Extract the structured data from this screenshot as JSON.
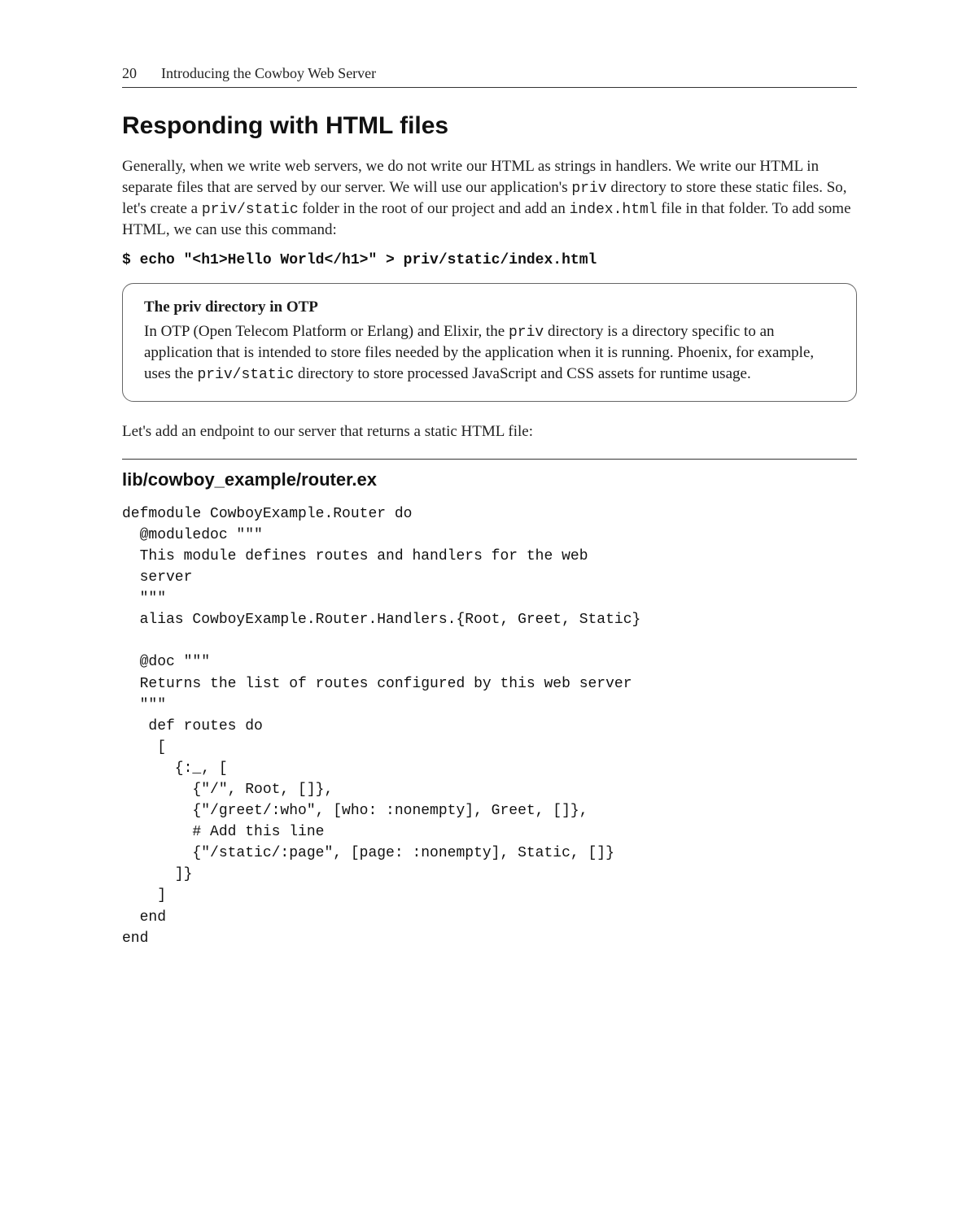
{
  "header": {
    "pageNumber": "20",
    "runningTitle": "Introducing the Cowboy Web Server"
  },
  "section": {
    "title": "Responding with HTML files",
    "para1_a": "Generally, when we write web servers, we do not write our HTML as strings in handlers. We write our HTML in separate files that are served by our server. We will use our application's ",
    "para1_code1": "priv",
    "para1_b": " directory to store these static files. So, let's create a ",
    "para1_code2": "priv/static",
    "para1_c": " folder in the root of our project and add an ",
    "para1_code3": "index.html",
    "para1_d": " file in that folder. To add some HTML, we can use this command:",
    "command": "$ echo \"<h1>Hello World</h1>\" > priv/static/index.html",
    "note": {
      "title": "The priv directory in OTP",
      "body_a": "In OTP (Open Telecom Platform or Erlang) and Elixir, the ",
      "body_code1": "priv",
      "body_b": " directory is a directory specific to an application that is intended to store files needed by the application when it is running. Phoenix, for example, uses the ",
      "body_code2": "priv/static",
      "body_c": " directory to store processed JavaScript and CSS assets for runtime usage."
    },
    "para2": "Let's add an endpoint to our server that returns a static HTML file:",
    "fileHeading": "lib/cowboy_example/router.ex",
    "code": "defmodule CowboyExample.Router do\n  @moduledoc \"\"\"\n  This module defines routes and handlers for the web\n  server\n  \"\"\"\n  alias CowboyExample.Router.Handlers.{Root, Greet, Static}\n\n  @doc \"\"\"\n  Returns the list of routes configured by this web server\n  \"\"\"\n   def routes do\n    [\n      {:_, [\n        {\"/\", Root, []},\n        {\"/greet/:who\", [who: :nonempty], Greet, []},\n        # Add this line\n        {\"/static/:page\", [page: :nonempty], Static, []}\n      ]}\n    ]\n  end\nend"
  }
}
